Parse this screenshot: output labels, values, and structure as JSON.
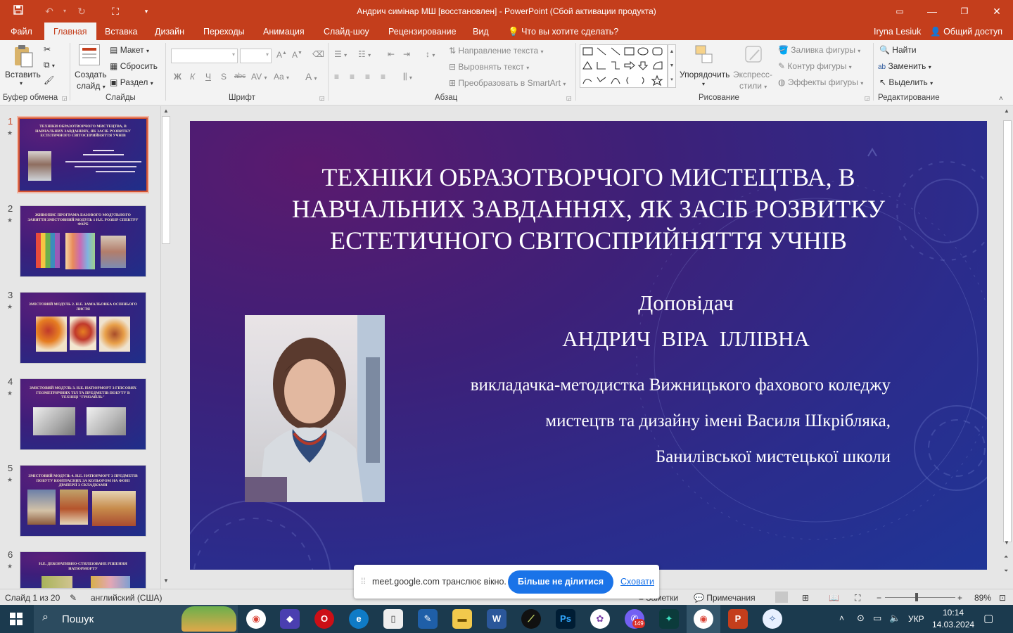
{
  "window": {
    "title": "Андрич симінар МШ [восстановлен] - PowerPoint (Сбой активации продукта)"
  },
  "tabs": [
    {
      "label": "Файл"
    },
    {
      "label": "Главная"
    },
    {
      "label": "Вставка"
    },
    {
      "label": "Дизайн"
    },
    {
      "label": "Переходы"
    },
    {
      "label": "Анимация"
    },
    {
      "label": "Слайд-шоу"
    },
    {
      "label": "Рецензирование"
    },
    {
      "label": "Вид"
    }
  ],
  "tell_me": "Что вы хотите сделать?",
  "user": "Iryna Lesiuk",
  "share": "Общий доступ",
  "ribbon": {
    "clipboard": {
      "paste": "Вставить",
      "label": "Буфер обмена"
    },
    "slides": {
      "new_slide_1": "Создать",
      "new_slide_2": "слайд",
      "layout": "Макет",
      "reset": "Сбросить",
      "section": "Раздел",
      "label": "Слайды"
    },
    "font": {
      "label": "Шрифт"
    },
    "paragraph": {
      "text_direction": "Направление текста",
      "align_text": "Выровнять текст",
      "smartart": "Преобразовать в SmartArt",
      "label": "Абзац"
    },
    "drawing": {
      "arrange": "Упорядочить",
      "quick_styles_1": "Экспресс-",
      "quick_styles_2": "стили",
      "shape_fill": "Заливка фигуры",
      "shape_outline": "Контур фигуры",
      "shape_effects": "Эффекты фигуры",
      "label": "Рисование"
    },
    "editing": {
      "find": "Найти",
      "replace": "Заменить",
      "select": "Выделить",
      "label": "Редактирование"
    }
  },
  "thumbnails": [
    {
      "num": "1",
      "title": "ТЕХНІКИ ОБРАЗОТВОРЧОГО МИСТЕЦТВА, В НАВЧАЛЬНИХ ЗАВДАННЯХ, ЯК ЗАСІБ РОЗВИТКУ ЕСТЕТИЧНОГО СВІТОСПРИЙНЯТТЯ УЧНІВ"
    },
    {
      "num": "2",
      "title": "ЖИВОПИС ПРОГРАМА БАЗОВОГО МОДУЛЬНОГО ЗАНЯТТЯ ЗМІСТОВНИЙ МОДУЛЬ 1 Н.Е. РОЗБІР СПЕКТРУ ФАРБ"
    },
    {
      "num": "3",
      "title": "ЗМІСТОВИЙ МОДУЛЬ 2. Н.Е. ЗАМАЛЬОВКА ОСІННЬОГО ЛИСТЯ"
    },
    {
      "num": "4",
      "title": "ЗМІСТОВИЙ МОДУЛЬ 3. Н.Е. НАТЮРМОРТ З ГІПСОВИХ ГЕОМЕТРИЧНИХ ТІЛ ТА ПРЕДМЕТІВ ПОБУТУ В ТЕХНІЦІ \"ГРИЗАЙЛЬ\""
    },
    {
      "num": "5",
      "title": "ЗМІСТОВИЙ МОДУЛЬ 4. Н.Е. НАТЮРМОРТ З ПРЕДМЕТІВ ПОБУТУ КОНТРАСНИХ ЗА КОЛЬОРОМ НА ФОНІ ДРАПЕРІЇ З СКЛАДКАМИ"
    },
    {
      "num": "6",
      "title": "Н.Е. ДЕКОРАТИВНО-СТИЛІЗОВАНЕ РІШЕННЯ НАТЮРМОРТУ"
    }
  ],
  "slide": {
    "title_1": "ТЕХНІКИ ОБРАЗОТВОРЧОГО МИСТЕЦТВА, В",
    "title_2": "НАВЧАЛЬНИХ ЗАВДАННЯХ, ЯК ЗАСІБ РОЗВИТКУ",
    "title_3": "ЕСТЕТИЧНОГО СВІТОСПРИЙНЯТТЯ УЧНІВ",
    "speaker_label": "Доповідач",
    "speaker_name": "АНДРИЧ  ВІРА  ІЛЛІВНА",
    "line_1": "викладачка-методистка Вижницького фахового коледжу",
    "line_2": "мистецтв та дизайну імені Василя Шкрібляка,",
    "line_3": "Банилівської мистецької школи"
  },
  "statusbar": {
    "slide_info": "Слайд 1 из 20",
    "language": "английский (США)",
    "notes": "Заметки",
    "comments": "Примечания",
    "zoom": "89%"
  },
  "meet": {
    "message": "meet.google.com транслює вікно.",
    "stop_button": "Більше не ділитися",
    "hide_link": "Сховати"
  },
  "taskbar": {
    "search": "Пошук",
    "lang": "УКР",
    "time": "10:14",
    "date": "14.03.2024",
    "viber_badge": "149"
  }
}
